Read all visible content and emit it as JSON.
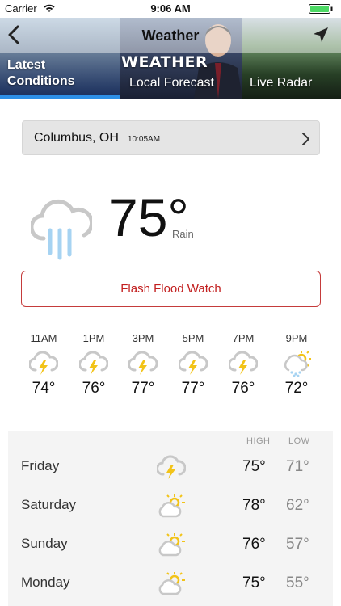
{
  "status_bar": {
    "carrier": "Carrier",
    "time": "9:06 AM"
  },
  "nav": {
    "title": "Weather"
  },
  "tabs": [
    {
      "label": "Latest Conditions",
      "selected": true
    },
    {
      "label": "Local Forecast",
      "selected": false
    },
    {
      "label": "Live Radar",
      "selected": false
    }
  ],
  "tab_brand": "WEATHER",
  "location": {
    "city": "Columbus, OH",
    "time": "10:05AM"
  },
  "current": {
    "temp": "75°",
    "condition": "Rain"
  },
  "alert": {
    "label": "Flash Flood Watch"
  },
  "hourly": [
    {
      "time": "11AM",
      "icon": "thunderstorm-icon",
      "temp": "74°"
    },
    {
      "time": "1PM",
      "icon": "thunderstorm-icon",
      "temp": "76°"
    },
    {
      "time": "3PM",
      "icon": "thunderstorm-icon",
      "temp": "77°"
    },
    {
      "time": "5PM",
      "icon": "thunderstorm-icon",
      "temp": "77°"
    },
    {
      "time": "7PM",
      "icon": "thunderstorm-icon",
      "temp": "76°"
    },
    {
      "time": "9PM",
      "icon": "sun-rain-icon",
      "temp": "72°"
    }
  ],
  "daily": {
    "high_label": "HIGH",
    "low_label": "LOW",
    "days": [
      {
        "name": "Friday",
        "icon": "thunderstorm-icon",
        "high": "75°",
        "low": "71°"
      },
      {
        "name": "Saturday",
        "icon": "partly-cloudy-icon",
        "high": "78°",
        "low": "62°"
      },
      {
        "name": "Sunday",
        "icon": "partly-cloudy-icon",
        "high": "76°",
        "low": "57°"
      },
      {
        "name": "Monday",
        "icon": "partly-cloudy-icon",
        "high": "75°",
        "low": "55°"
      }
    ]
  },
  "colors": {
    "accent_blue": "#2d8fe6",
    "alert_red": "#c21f1f",
    "rain_blue": "#a6d3f2",
    "sun_yellow": "#f2c318"
  }
}
